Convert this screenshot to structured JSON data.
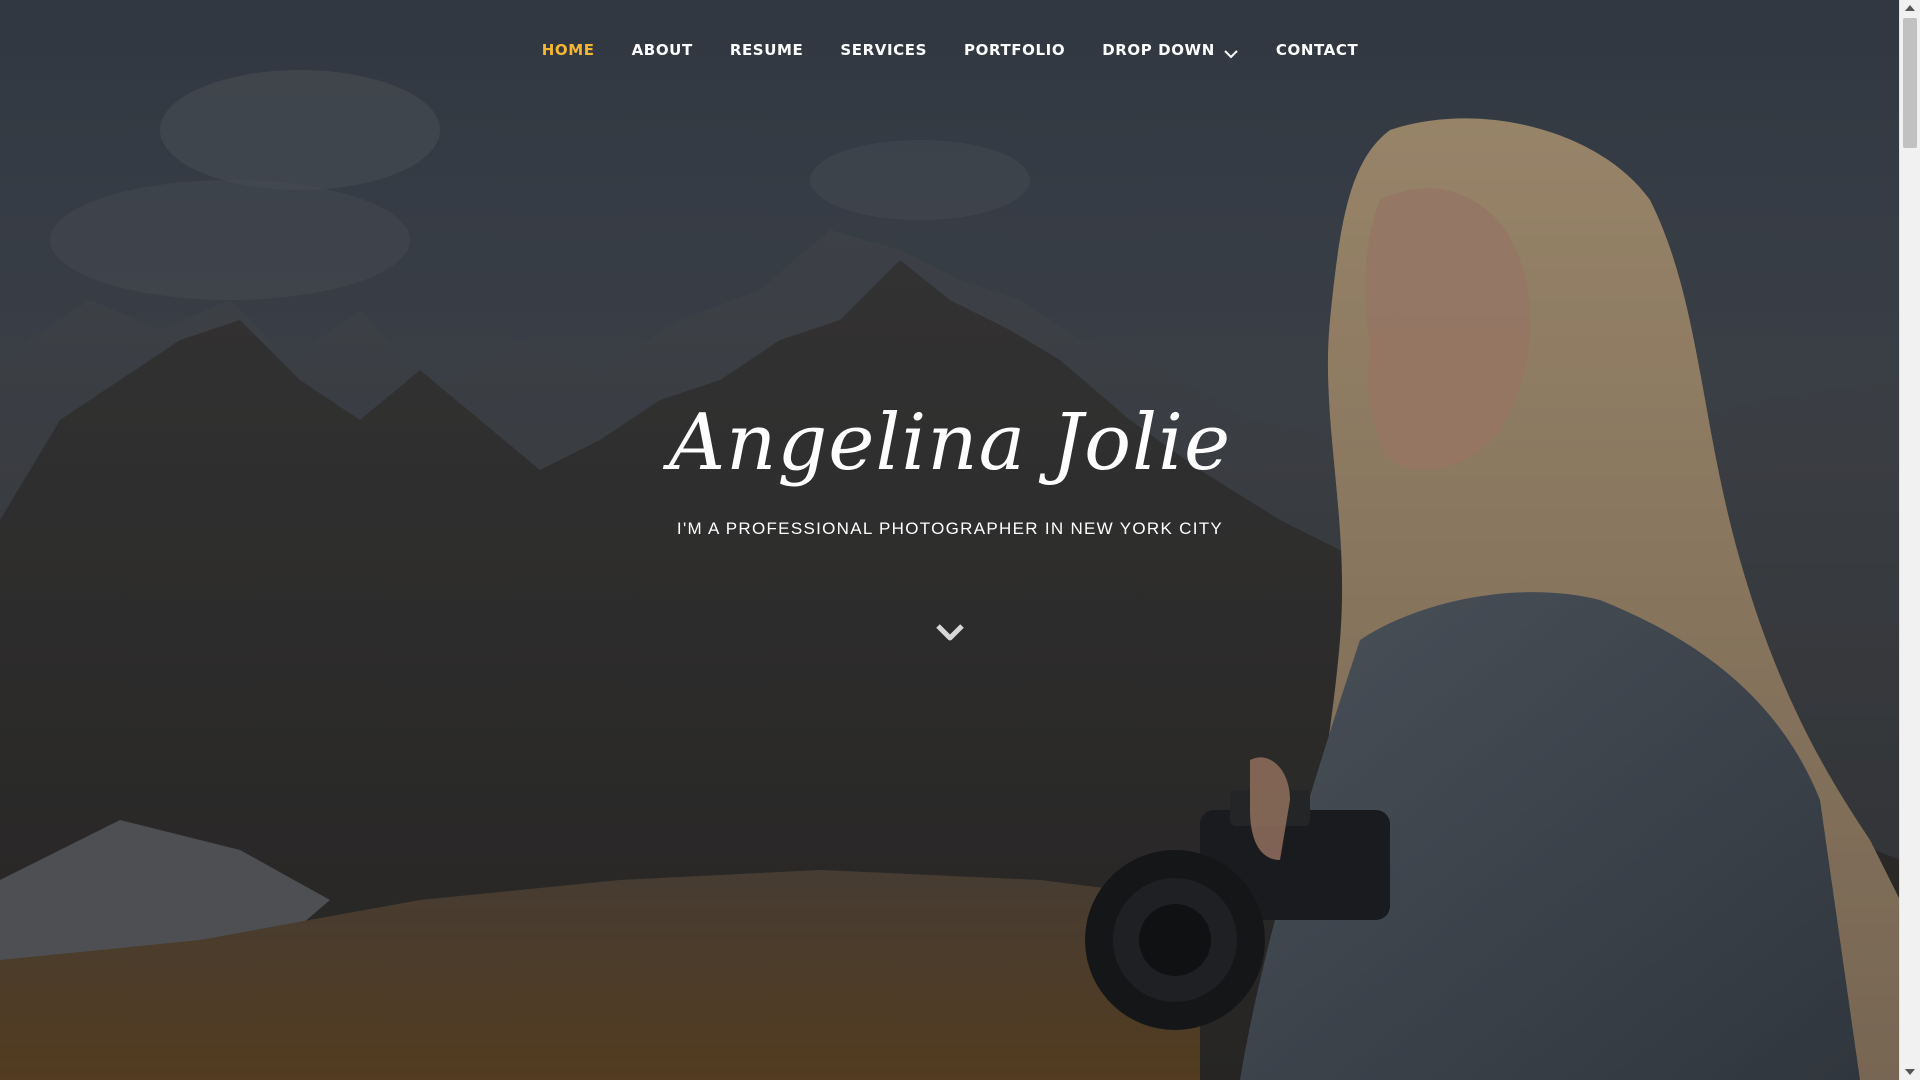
{
  "nav": {
    "items": [
      {
        "label": "HOME",
        "active": true
      },
      {
        "label": "ABOUT",
        "active": false
      },
      {
        "label": "RESUME",
        "active": false
      },
      {
        "label": "SERVICES",
        "active": false
      },
      {
        "label": "PORTFOLIO",
        "active": false
      },
      {
        "label": "DROP DOWN",
        "active": false,
        "has_dropdown": true
      },
      {
        "label": "CONTACT",
        "active": false
      }
    ],
    "active_color": "#f5b731",
    "text_color": "#ffffff"
  },
  "hero": {
    "title": "Angelina Jolie",
    "subtitle": "I'M A PROFESSIONAL PHOTOGRAPHER IN NEW YORK CITY",
    "scroll_icon": "chevron-down-icon",
    "background_description_icon": "mountains-photographer-background"
  }
}
